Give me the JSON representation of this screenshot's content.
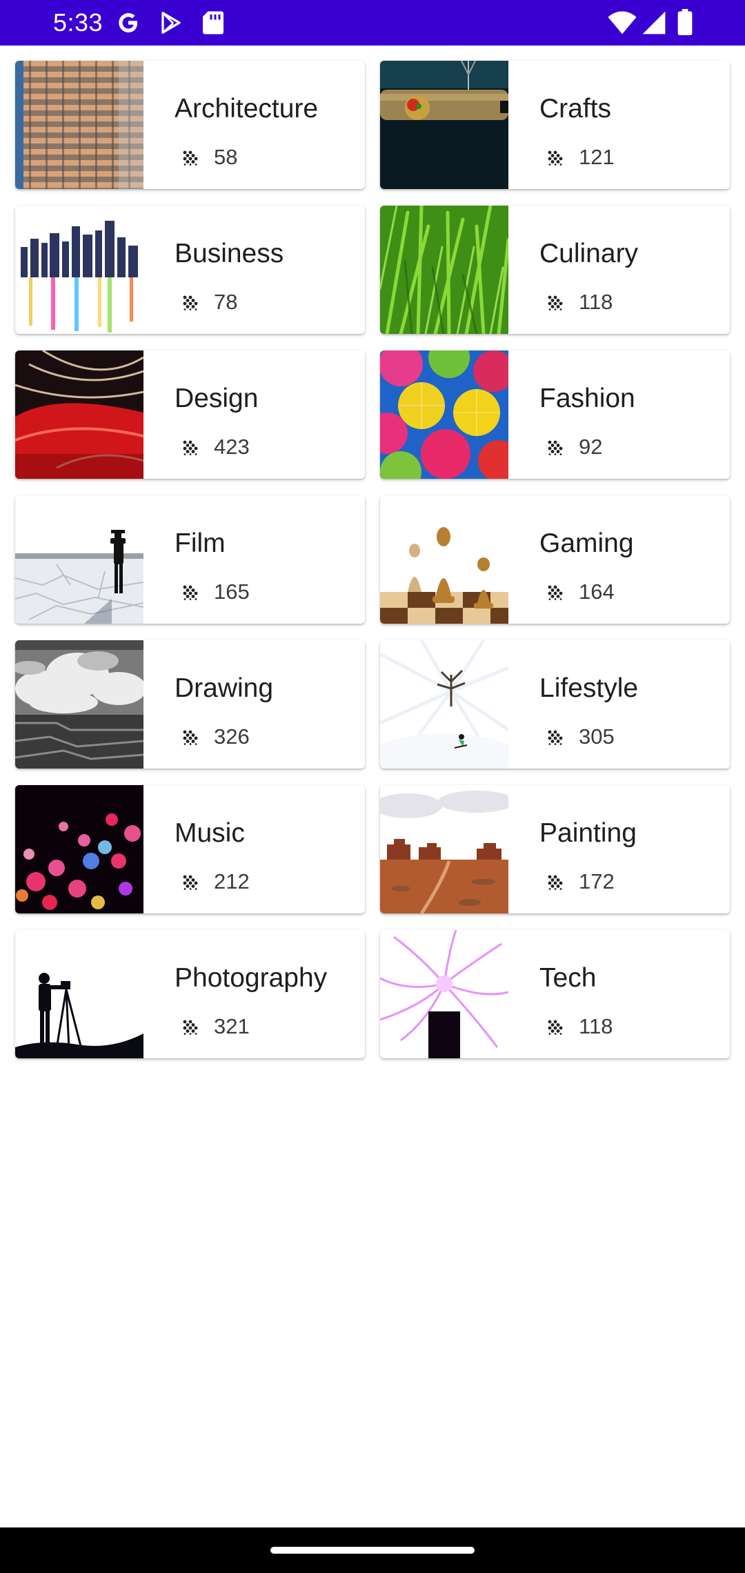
{
  "status_bar": {
    "time": "5:33",
    "left_icons": [
      "google-g-icon",
      "play-store-icon",
      "sd-card-icon"
    ],
    "right_icons": [
      "wifi-icon",
      "cellular-signal-icon",
      "battery-icon"
    ],
    "background": "#3a00d1"
  },
  "topics": [
    {
      "title": "Architecture",
      "count": "58",
      "image": "architecture-photo"
    },
    {
      "title": "Crafts",
      "count": "121",
      "image": "crafts-photo"
    },
    {
      "title": "Business",
      "count": "78",
      "image": "business-photo"
    },
    {
      "title": "Culinary",
      "count": "118",
      "image": "culinary-photo"
    },
    {
      "title": "Design",
      "count": "423",
      "image": "design-photo"
    },
    {
      "title": "Fashion",
      "count": "92",
      "image": "fashion-photo"
    },
    {
      "title": "Film",
      "count": "165",
      "image": "film-photo"
    },
    {
      "title": "Gaming",
      "count": "164",
      "image": "gaming-photo"
    },
    {
      "title": "Drawing",
      "count": "326",
      "image": "drawing-photo"
    },
    {
      "title": "Lifestyle",
      "count": "305",
      "image": "lifestyle-photo"
    },
    {
      "title": "Music",
      "count": "212",
      "image": "music-photo"
    },
    {
      "title": "Painting",
      "count": "172",
      "image": "painting-photo"
    },
    {
      "title": "Photography",
      "count": "321",
      "image": "photography-photo"
    },
    {
      "title": "Tech",
      "count": "118",
      "image": "tech-photo"
    }
  ],
  "count_icon": "grain-icon",
  "nav_bar": {
    "background": "#000000"
  }
}
